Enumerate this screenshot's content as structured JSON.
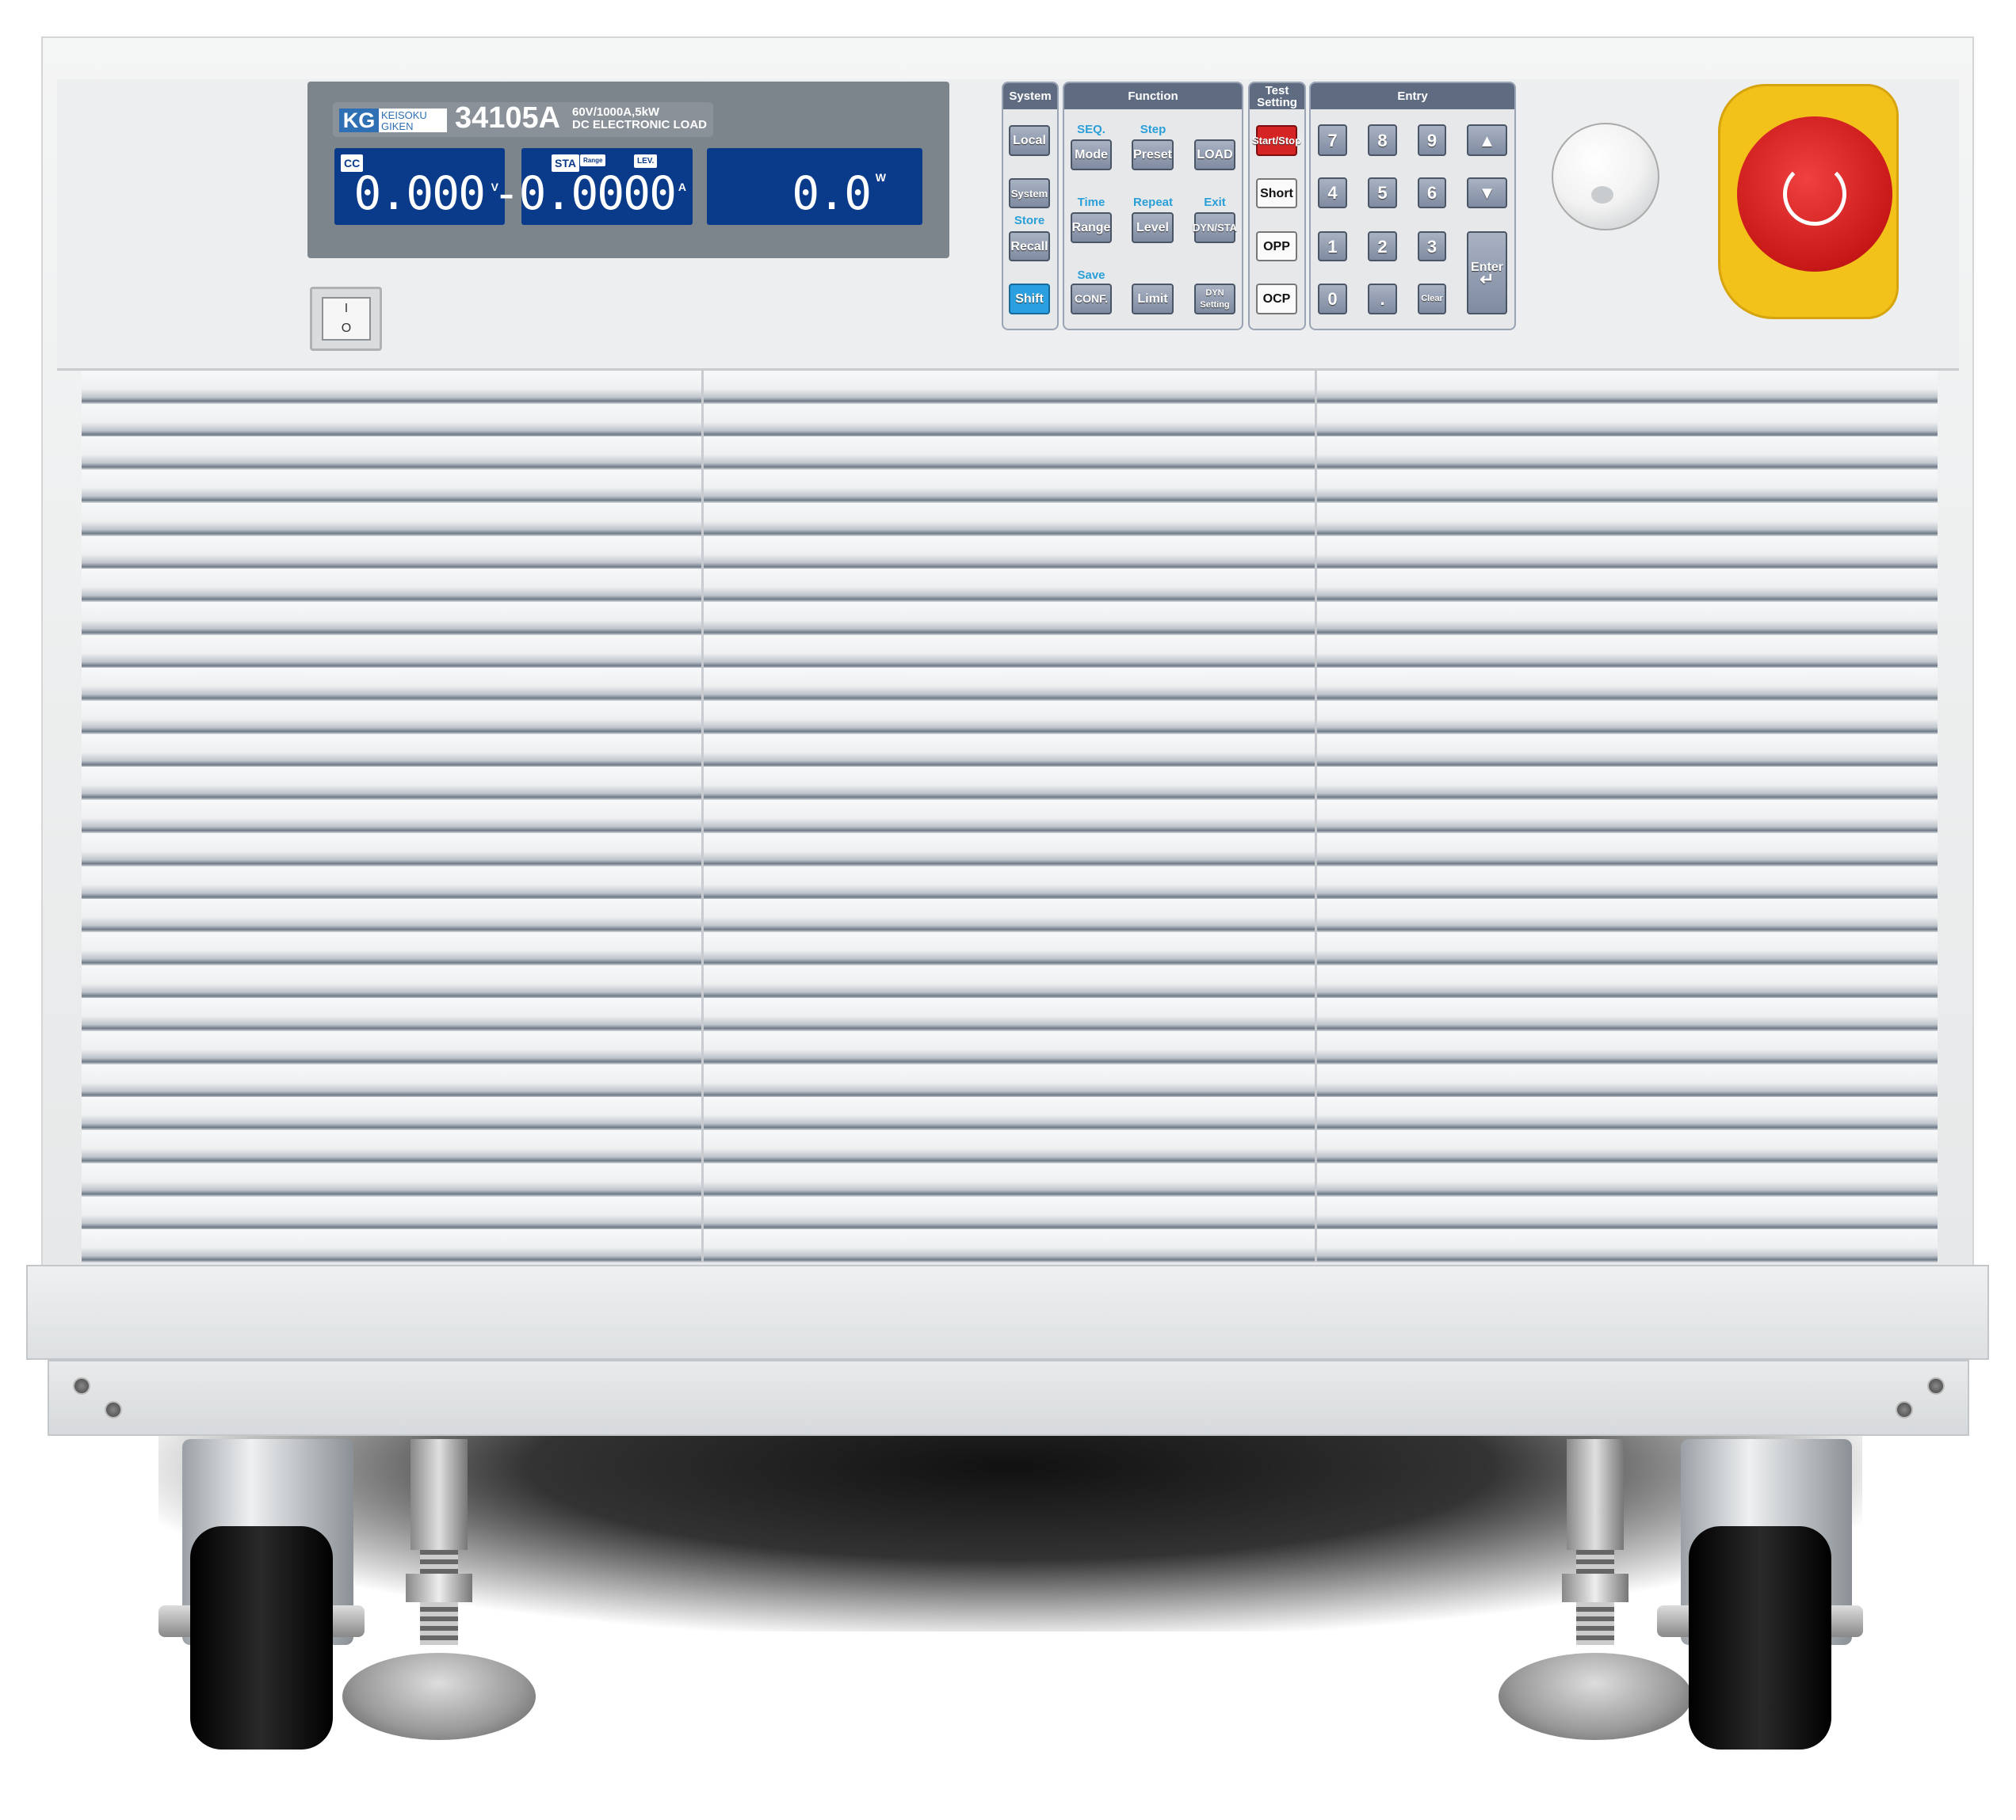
{
  "brand": {
    "logo": "KG",
    "name_line1": "KEISOKU",
    "name_line2": "GIKEN",
    "model": "34105A",
    "spec_line1": "60V/1000A,5kW",
    "spec_line2": "DC ELECTRONIC LOAD"
  },
  "lcd": {
    "voltage": {
      "mode_tag": "CC",
      "value": "0.000",
      "unit": "V"
    },
    "current": {
      "tags": [
        "STA",
        "Range",
        "LEV."
      ],
      "value": "-0.0000",
      "unit": "A"
    },
    "power": {
      "value": "0.0",
      "unit": "W"
    }
  },
  "power_switch": {
    "symbol_on": "I",
    "symbol_off": "O"
  },
  "keypad": {
    "system": {
      "title": "System",
      "buttons": [
        "Local",
        "System",
        "Recall",
        "Shift"
      ],
      "shift_labels": {
        "store": "Store"
      }
    },
    "function": {
      "title": "Function",
      "buttons": [
        "Mode",
        "Preset",
        "LOAD",
        "Range",
        "Level",
        "DYN/STA",
        "CONF.",
        "Limit",
        "DYN Setting"
      ],
      "shift_labels": [
        "SEQ.",
        "Step",
        "Time",
        "Repeat",
        "Exit",
        "Save"
      ]
    },
    "test": {
      "title": "Test Setting",
      "buttons": [
        "Start/Stop",
        "Short",
        "OPP",
        "OCP"
      ]
    },
    "entry": {
      "title": "Entry",
      "buttons": [
        "7",
        "8",
        "9",
        "4",
        "5",
        "6",
        "1",
        "2",
        "3",
        "0",
        ".",
        "Clear",
        "Enter"
      ]
    }
  },
  "colors": {
    "lcd": "#0a3a8a",
    "accent_blue": "#2a9fd8",
    "start_red": "#d42424",
    "estop_red": "#c81818",
    "estop_yellow": "#f2c21a"
  },
  "icons": [
    "power-switch-icon",
    "rotary-knob-icon",
    "emergency-stop-icon",
    "arrow-up-icon",
    "arrow-down-icon",
    "enter-return-icon"
  ]
}
